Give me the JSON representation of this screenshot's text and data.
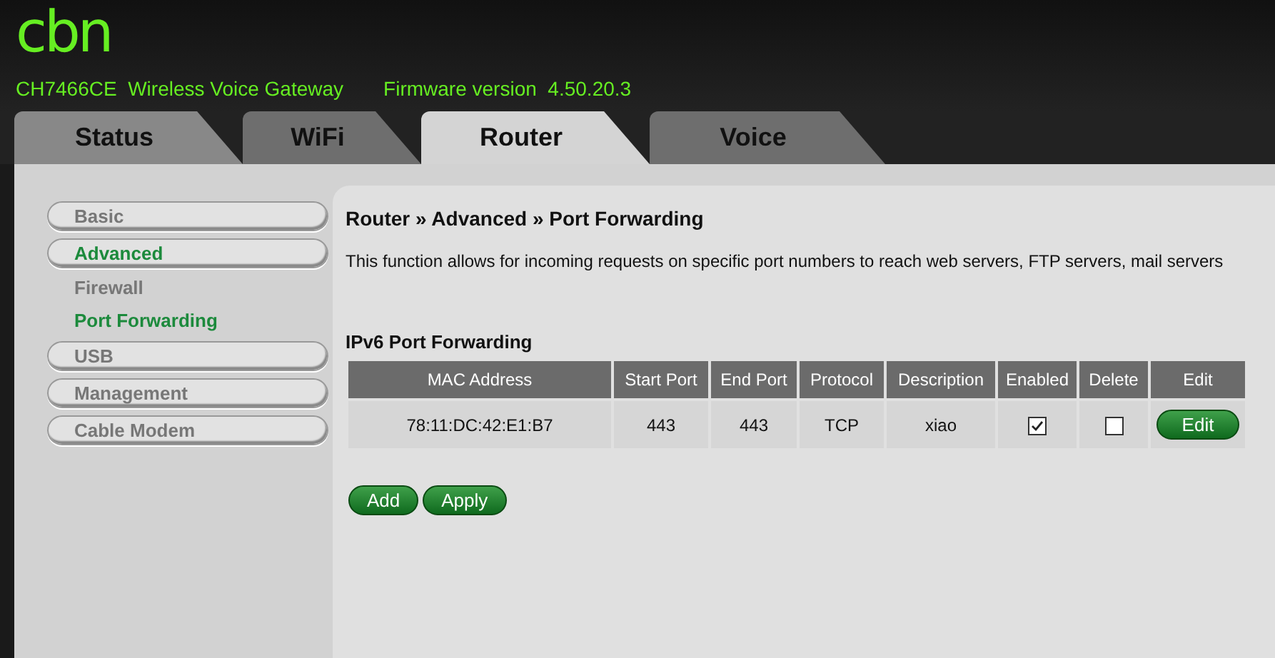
{
  "header": {
    "logo": "cbn",
    "model": "CH7466CE  Wireless Voice Gateway",
    "firmware": "Firmware version  4.50.20.3"
  },
  "tabs": [
    {
      "label": "Status",
      "selected": false
    },
    {
      "label": "WiFi",
      "selected": false
    },
    {
      "label": "Router",
      "selected": true
    },
    {
      "label": "Voice",
      "selected": false
    }
  ],
  "sidebar": {
    "items": [
      {
        "kind": "pill",
        "label": "Basic",
        "selected": false
      },
      {
        "kind": "pill",
        "label": "Advanced",
        "selected": true
      },
      {
        "kind": "sub",
        "label": "Firewall",
        "selected": false
      },
      {
        "kind": "sub",
        "label": "Port Forwarding",
        "selected": true
      },
      {
        "kind": "pill",
        "label": "USB",
        "selected": false
      },
      {
        "kind": "pill",
        "label": "Management",
        "selected": false
      },
      {
        "kind": "pill",
        "label": "Cable Modem",
        "selected": false
      }
    ]
  },
  "content": {
    "breadcrumb": "Router » Advanced » Port Forwarding",
    "description": "This function allows for incoming requests on specific port numbers to reach web servers, FTP servers, mail servers",
    "section_title": "IPv6 Port Forwarding",
    "table": {
      "columns": [
        "MAC Address",
        "Start Port",
        "End Port",
        "Protocol",
        "Description",
        "Enabled",
        "Delete",
        "Edit"
      ],
      "rows": [
        {
          "cells": [
            {
              "kind": "text",
              "text": "78:11:DC:42:E1:B7"
            },
            {
              "kind": "text",
              "text": "443"
            },
            {
              "kind": "text",
              "text": "443"
            },
            {
              "kind": "text",
              "text": "TCP"
            },
            {
              "kind": "text",
              "text": "xiao"
            },
            {
              "kind": "checkbox",
              "checked": true
            },
            {
              "kind": "checkbox",
              "checked": false
            },
            {
              "kind": "button",
              "text": "Edit"
            }
          ]
        }
      ]
    },
    "buttons": [
      "Add",
      "Apply"
    ]
  }
}
